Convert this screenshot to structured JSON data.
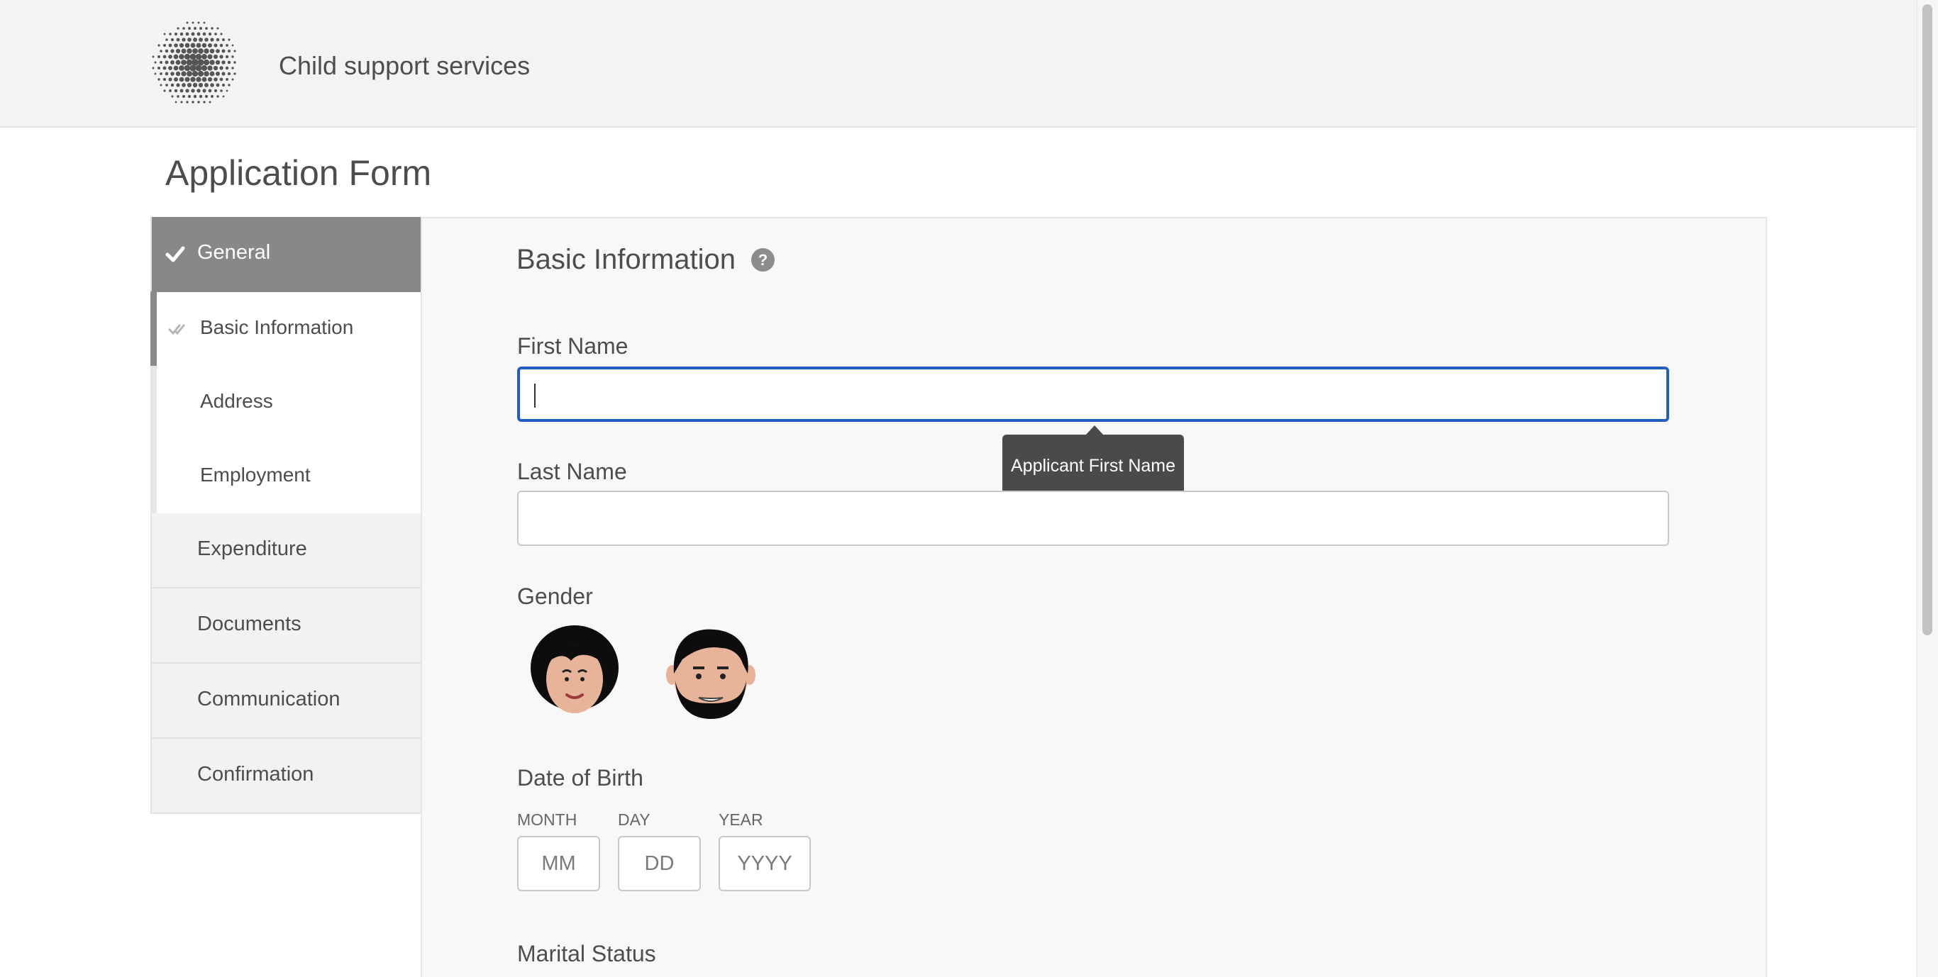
{
  "header": {
    "app_title": "Child support services",
    "logo_icon": "dotted-globe-logo"
  },
  "page": {
    "title": "Application Form"
  },
  "sidebar": {
    "items": [
      {
        "label": "General",
        "state": "active",
        "icon": "check-icon"
      },
      {
        "label": "Expenditure"
      },
      {
        "label": "Documents"
      },
      {
        "label": "Communication"
      },
      {
        "label": "Confirmation"
      }
    ],
    "sub_items": [
      {
        "label": "Basic Information",
        "state": "current",
        "icon": "double-check-icon"
      },
      {
        "label": "Address"
      },
      {
        "label": "Employment"
      }
    ]
  },
  "form": {
    "section_title": "Basic Information",
    "help_icon": "question-mark-icon",
    "help_symbol": "?",
    "first_name": {
      "label": "First Name",
      "value": "",
      "tooltip": "Applicant First Name"
    },
    "last_name": {
      "label": "Last Name",
      "value": ""
    },
    "gender": {
      "label": "Gender",
      "options": [
        "female-avatar",
        "male-avatar"
      ]
    },
    "dob": {
      "label": "Date of Birth",
      "month_label": "MONTH",
      "month_placeholder": "MM",
      "day_label": "DAY",
      "day_placeholder": "DD",
      "year_label": "YEAR",
      "year_placeholder": "YYYY"
    },
    "marital_status": {
      "label": "Marital Status"
    }
  },
  "colors": {
    "focus_border": "#1f5fbf",
    "active_tab": "#888888",
    "tooltip_bg": "#4a4a4a"
  }
}
